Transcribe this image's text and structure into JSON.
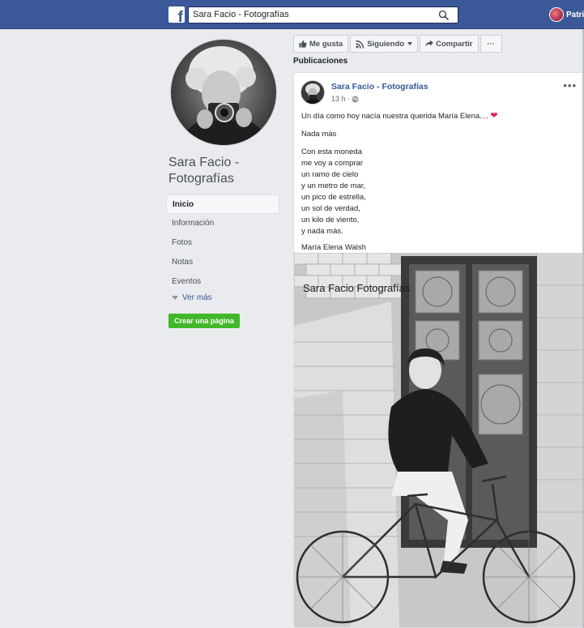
{
  "topbar": {
    "logo_letter": "f",
    "search_value": "Sara Facio - Fotografías",
    "user_name": "Patri"
  },
  "page": {
    "name": "Sara Facio - Fotografías"
  },
  "nav": {
    "items": [
      {
        "label": "Inicio"
      },
      {
        "label": "Información"
      },
      {
        "label": "Fotos"
      },
      {
        "label": "Notas"
      },
      {
        "label": "Eventos"
      }
    ],
    "see_more": "Ver más",
    "create_page": "Crear una página"
  },
  "actions": {
    "like": "Me gusta",
    "following": "Siguiendo",
    "share": "Compartir",
    "more": "···"
  },
  "section_title": "Publicaciones",
  "post": {
    "author": "Sara Facio - Fotografías",
    "time": "13 h ·",
    "line1": "Un día como hoy nacía nuestra querida María Elena.... ",
    "line2": "Nada más",
    "poem": [
      "Con esta moneda",
      "me voy a comprar",
      "un ramo de cielo",
      "y un metro de mar,",
      "un pico de estrella,",
      "un sol de verdad,",
      "un kilo de viento,",
      "y nada más."
    ],
    "signature": "María Elena Walsh",
    "photo_watermark": "Sara Facio Fotografías",
    "menu": "•••"
  },
  "colors": {
    "topbar": "#3b5998",
    "link": "#365899",
    "create_button": "#42b72a",
    "heart": "#e0245e"
  }
}
